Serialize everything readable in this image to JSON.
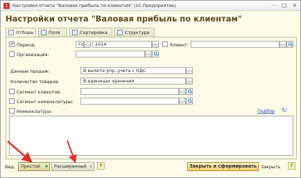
{
  "window": {
    "title": "Настройки отчета \"Валовая прибыль по клиентам\"  (1С:Предприятие)",
    "app_icon": "1c-app-icon"
  },
  "heading": "Настройки отчета \"Валовая прибыль по клиентам\"",
  "tabs": [
    {
      "label": "Отборы",
      "active": true
    },
    {
      "label": "Поля",
      "active": false
    },
    {
      "label": "Сортировка",
      "active": false
    },
    {
      "label": "Структура",
      "active": false
    }
  ],
  "filters": {
    "period": {
      "label": "Период:",
      "checked": true,
      "unit": "Год",
      "value": "2014"
    },
    "client": {
      "label": "Клиент:",
      "checked": false,
      "value": ""
    },
    "organization": {
      "label": "Организация:",
      "checked": false,
      "value": ""
    },
    "sales_data": {
      "label": "Данные продаж:",
      "value": "В валюте упр. учета с НДС"
    },
    "goods_qty": {
      "label": "Количество товаров:",
      "value": "В единицах хранения"
    },
    "client_segment": {
      "label": "Сегмент клиентов:",
      "checked": false,
      "value": ""
    },
    "nomen_segment": {
      "label": "Сегмент номенклатуры:",
      "checked": false,
      "value": ""
    },
    "nomenclature": {
      "label": "Номенклатура:",
      "checked": false,
      "pick_link": "Подбор"
    }
  },
  "bottom": {
    "view_label": "Вид:",
    "simple_label": "Простой",
    "extended_label": "Расширенный",
    "help_label": "?",
    "close_and_build_label": "Закрыть и сформировать",
    "close_label": "Закрыть"
  },
  "annotation_color": "#e0322b"
}
